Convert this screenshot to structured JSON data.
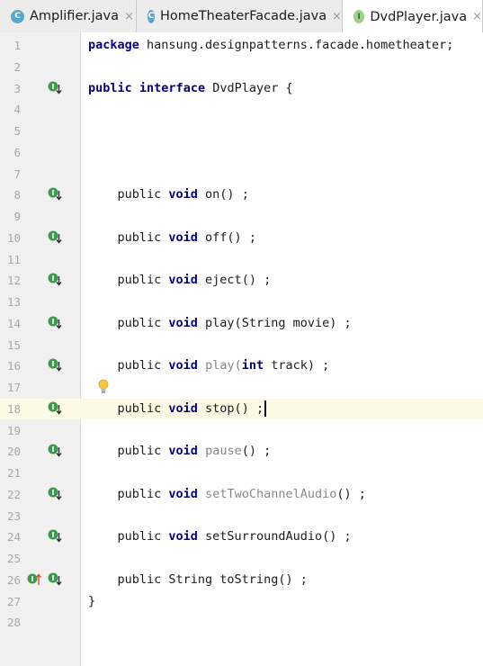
{
  "tabs": [
    {
      "label": "Amplifier.java",
      "icon": "class-icon",
      "icon_letter": "C",
      "active": false
    },
    {
      "label": "HomeTheaterFacade.java",
      "icon": "class-icon",
      "icon_letter": "C",
      "active": false
    },
    {
      "label": "DvdPlayer.java",
      "icon": "interface-icon",
      "icon_letter": "I",
      "active": true
    }
  ],
  "tab_close_glyph": "×",
  "editor": {
    "current_line": 18,
    "lines": [
      {
        "n": "1",
        "tokens": [
          {
            "t": "package",
            "k": "kw"
          },
          {
            "t": " hansung.designpatterns.facade.hometheater;"
          }
        ]
      },
      {
        "n": "2",
        "tokens": []
      },
      {
        "n": "3",
        "tokens": [
          {
            "t": "public",
            "k": "kw"
          },
          {
            "t": " "
          },
          {
            "t": "interface",
            "k": "kw"
          },
          {
            "t": " DvdPlayer {"
          }
        ],
        "marker": "implemented"
      },
      {
        "n": "4",
        "tokens": []
      },
      {
        "n": "5",
        "tokens": []
      },
      {
        "n": "6",
        "tokens": []
      },
      {
        "n": "7",
        "tokens": []
      },
      {
        "n": "8",
        "tokens": [
          {
            "t": "    public "
          },
          {
            "t": "void",
            "k": "kw"
          },
          {
            "t": " on() ;"
          }
        ],
        "marker": "implemented"
      },
      {
        "n": "9",
        "tokens": []
      },
      {
        "n": "10",
        "tokens": [
          {
            "t": "    public "
          },
          {
            "t": "void",
            "k": "kw"
          },
          {
            "t": " off() ;"
          }
        ],
        "marker": "implemented"
      },
      {
        "n": "11",
        "tokens": []
      },
      {
        "n": "12",
        "tokens": [
          {
            "t": "    public "
          },
          {
            "t": "void",
            "k": "kw"
          },
          {
            "t": " eject() ;"
          }
        ],
        "marker": "implemented"
      },
      {
        "n": "13",
        "tokens": []
      },
      {
        "n": "14",
        "tokens": [
          {
            "t": "    public "
          },
          {
            "t": "void",
            "k": "kw"
          },
          {
            "t": " play(String movie) ;"
          }
        ],
        "marker": "implemented"
      },
      {
        "n": "15",
        "tokens": []
      },
      {
        "n": "16",
        "tokens": [
          {
            "t": "    public "
          },
          {
            "t": "void",
            "k": "kw"
          },
          {
            "t": " "
          },
          {
            "t": "play(",
            "k": "dim"
          },
          {
            "t": "int",
            "k": "kw"
          },
          {
            "t": " track) ;"
          }
        ],
        "marker": "implemented"
      },
      {
        "n": "17",
        "tokens": [],
        "bulb": true
      },
      {
        "n": "18",
        "tokens": [
          {
            "t": "    public "
          },
          {
            "t": "void",
            "k": "kw"
          },
          {
            "t": " stop() ;"
          }
        ],
        "marker": "implemented",
        "caret": true
      },
      {
        "n": "19",
        "tokens": []
      },
      {
        "n": "20",
        "tokens": [
          {
            "t": "    public "
          },
          {
            "t": "void",
            "k": "kw"
          },
          {
            "t": " "
          },
          {
            "t": "pause",
            "k": "dim"
          },
          {
            "t": "() ;"
          }
        ],
        "marker": "implemented"
      },
      {
        "n": "21",
        "tokens": []
      },
      {
        "n": "22",
        "tokens": [
          {
            "t": "    public "
          },
          {
            "t": "void",
            "k": "kw"
          },
          {
            "t": " "
          },
          {
            "t": "setTwoChannelAudio",
            "k": "dim"
          },
          {
            "t": "() ;"
          }
        ],
        "marker": "implemented"
      },
      {
        "n": "23",
        "tokens": []
      },
      {
        "n": "24",
        "tokens": [
          {
            "t": "    public "
          },
          {
            "t": "void",
            "k": "kw"
          },
          {
            "t": " setSurroundAudio() ;"
          }
        ],
        "marker": "implemented"
      },
      {
        "n": "25",
        "tokens": []
      },
      {
        "n": "26",
        "tokens": [
          {
            "t": "    public String toString() ;"
          }
        ],
        "marker": "overrides-and-implemented"
      },
      {
        "n": "27",
        "tokens": [
          {
            "t": "}"
          }
        ]
      },
      {
        "n": "28",
        "tokens": []
      }
    ]
  },
  "colors": {
    "keyword": "#000080",
    "current_line": "#fcfae4",
    "gutter": "#f0f0f0",
    "marker_green": "#3c9a4a",
    "override_red": "#d94a3a"
  }
}
